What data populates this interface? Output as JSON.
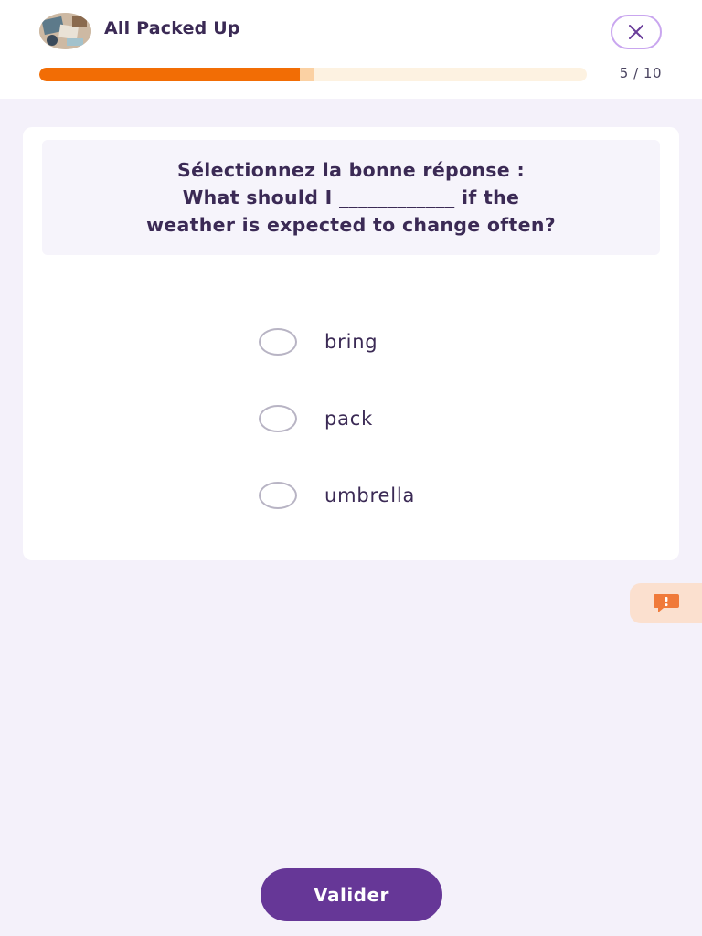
{
  "header": {
    "lesson_title": "All Packed Up",
    "close_icon": "close-icon",
    "progress": {
      "current": 5,
      "total": 10,
      "label": "5 / 10",
      "fraction": 0.5
    }
  },
  "question": {
    "instruction": "Sélectionnez la bonne réponse :",
    "line_1": "What should I ____________ if the",
    "line_2": "weather is expected to change often?"
  },
  "options": [
    {
      "label": "bring",
      "selected": false
    },
    {
      "label": "pack",
      "selected": false
    },
    {
      "label": "umbrella",
      "selected": false
    }
  ],
  "report_button": {
    "icon": "report-alert-icon"
  },
  "submit": {
    "label": "Valider"
  },
  "colors": {
    "accent": "#663797",
    "progress": "#f26d05",
    "background": "#f4f1fa",
    "report": "#f07a3a"
  }
}
